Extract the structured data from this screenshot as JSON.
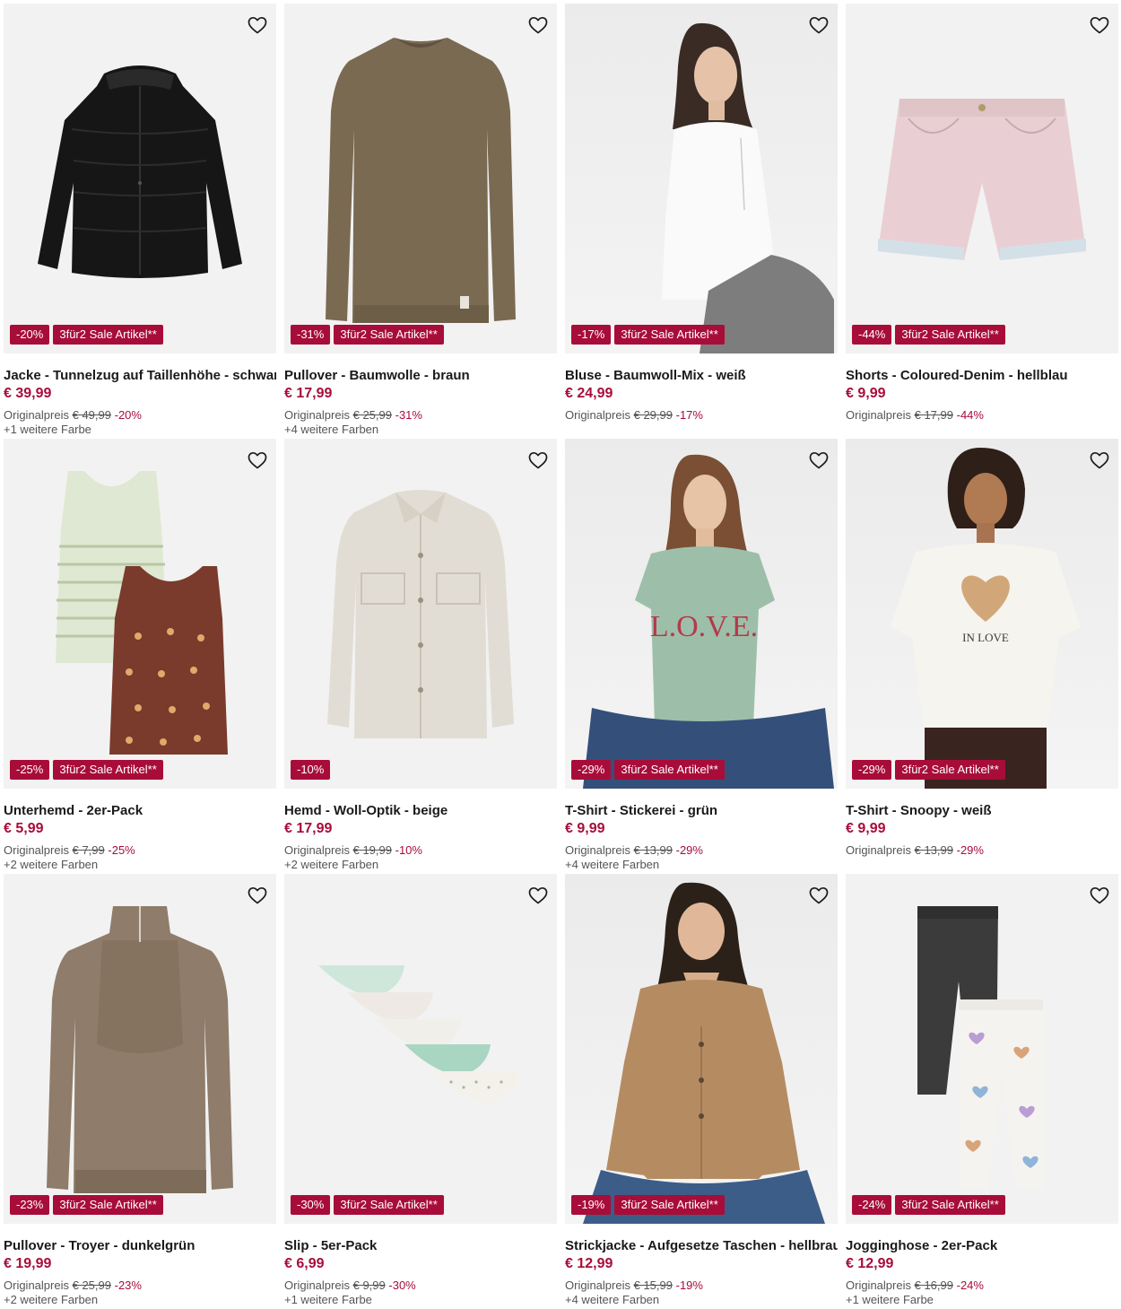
{
  "products": [
    {
      "title": "Jacke - Tunnelzug auf Taillenhöhe - schwarz",
      "price": "€ 39,99",
      "original_label": "Originalpreis",
      "original_price": "€ 49,99",
      "discount": "-20%",
      "badge_discount": "-20%",
      "badge_promo": "3für2 Sale Artikel**",
      "colors": "+1 weitere Farbe",
      "icon": "puffer-jacket-black"
    },
    {
      "title": "Pullover - Baumwolle - braun",
      "price": "€ 17,99",
      "original_label": "Originalpreis",
      "original_price": "€ 25,99",
      "discount": "-31%",
      "badge_discount": "-31%",
      "badge_promo": "3für2 Sale Artikel**",
      "colors": "+4 weitere Farben",
      "icon": "sweater-brown"
    },
    {
      "title": "Bluse - Baumwoll-Mix - weiß",
      "price": "€ 24,99",
      "original_label": "Originalpreis",
      "original_price": "€ 29,99",
      "discount": "-17%",
      "badge_discount": "-17%",
      "badge_promo": "3für2 Sale Artikel**",
      "colors": "",
      "icon": "model-white-blouse"
    },
    {
      "title": "Shorts - Coloured-Denim - hellblau",
      "price": "€ 9,99",
      "original_label": "Originalpreis",
      "original_price": "€ 17,99",
      "discount": "-44%",
      "badge_discount": "-44%",
      "badge_promo": "3für2 Sale Artikel**",
      "colors": "",
      "icon": "denim-shorts-pink"
    },
    {
      "title": "Unterhemd - 2er-Pack",
      "price": "€ 5,99",
      "original_label": "Originalpreis",
      "original_price": "€ 7,99",
      "discount": "-25%",
      "badge_discount": "-25%",
      "badge_promo": "3für2 Sale Artikel**",
      "colors": "+2 weitere Farben",
      "icon": "tank-tops"
    },
    {
      "title": "Hemd - Woll-Optik - beige",
      "price": "€ 17,99",
      "original_label": "Originalpreis",
      "original_price": "€ 19,99",
      "discount": "-10%",
      "badge_discount": "-10%",
      "badge_promo": "",
      "colors": "+2 weitere Farben",
      "icon": "overshirt-beige"
    },
    {
      "title": "T-Shirt - Stickerei - grün",
      "price": "€ 9,99",
      "original_label": "Originalpreis",
      "original_price": "€ 13,99",
      "discount": "-29%",
      "badge_discount": "-29%",
      "badge_promo": "3für2 Sale Artikel**",
      "colors": "+4 weitere Farben",
      "icon": "model-green-tshirt"
    },
    {
      "title": "T-Shirt - Snoopy - weiß",
      "price": "€ 9,99",
      "original_label": "Originalpreis",
      "original_price": "€ 13,99",
      "discount": "-29%",
      "badge_discount": "-29%",
      "badge_promo": "3für2 Sale Artikel**",
      "colors": "",
      "icon": "model-snoopy-tshirt"
    },
    {
      "title": "Pullover - Troyer - dunkelgrün",
      "price": "€ 19,99",
      "original_label": "Originalpreis",
      "original_price": "€ 25,99",
      "discount": "-23%",
      "badge_discount": "-23%",
      "badge_promo": "3für2 Sale Artikel**",
      "colors": "+2 weitere Farben",
      "icon": "troyer-sweater"
    },
    {
      "title": "Slip - 5er-Pack",
      "price": "€ 6,99",
      "original_label": "Originalpreis",
      "original_price": "€ 9,99",
      "discount": "-30%",
      "badge_discount": "-30%",
      "badge_promo": "3für2 Sale Artikel**",
      "colors": "+1 weitere Farbe",
      "icon": "briefs-pack"
    },
    {
      "title": "Strickjacke - Aufgesetze Taschen - hellbraun",
      "price": "€ 12,99",
      "original_label": "Originalpreis",
      "original_price": "€ 15,99",
      "discount": "-19%",
      "badge_discount": "-19%",
      "badge_promo": "3für2 Sale Artikel**",
      "colors": "+4 weitere Farben",
      "icon": "model-cardigan"
    },
    {
      "title": "Jogginghose - 2er-Pack",
      "price": "€ 12,99",
      "original_label": "Originalpreis",
      "original_price": "€ 16,99",
      "discount": "-24%",
      "badge_discount": "-24%",
      "badge_promo": "3für2 Sale Artikel**",
      "colors": "+1 weitere Farbe",
      "icon": "jogging-pants"
    }
  ],
  "image_text": {
    "love_print": "L.O.V.E.",
    "snoopy_print": "IN LOVE"
  },
  "theme": {
    "accent": "#a80d3a",
    "image_bg": "#f2f2f2"
  }
}
